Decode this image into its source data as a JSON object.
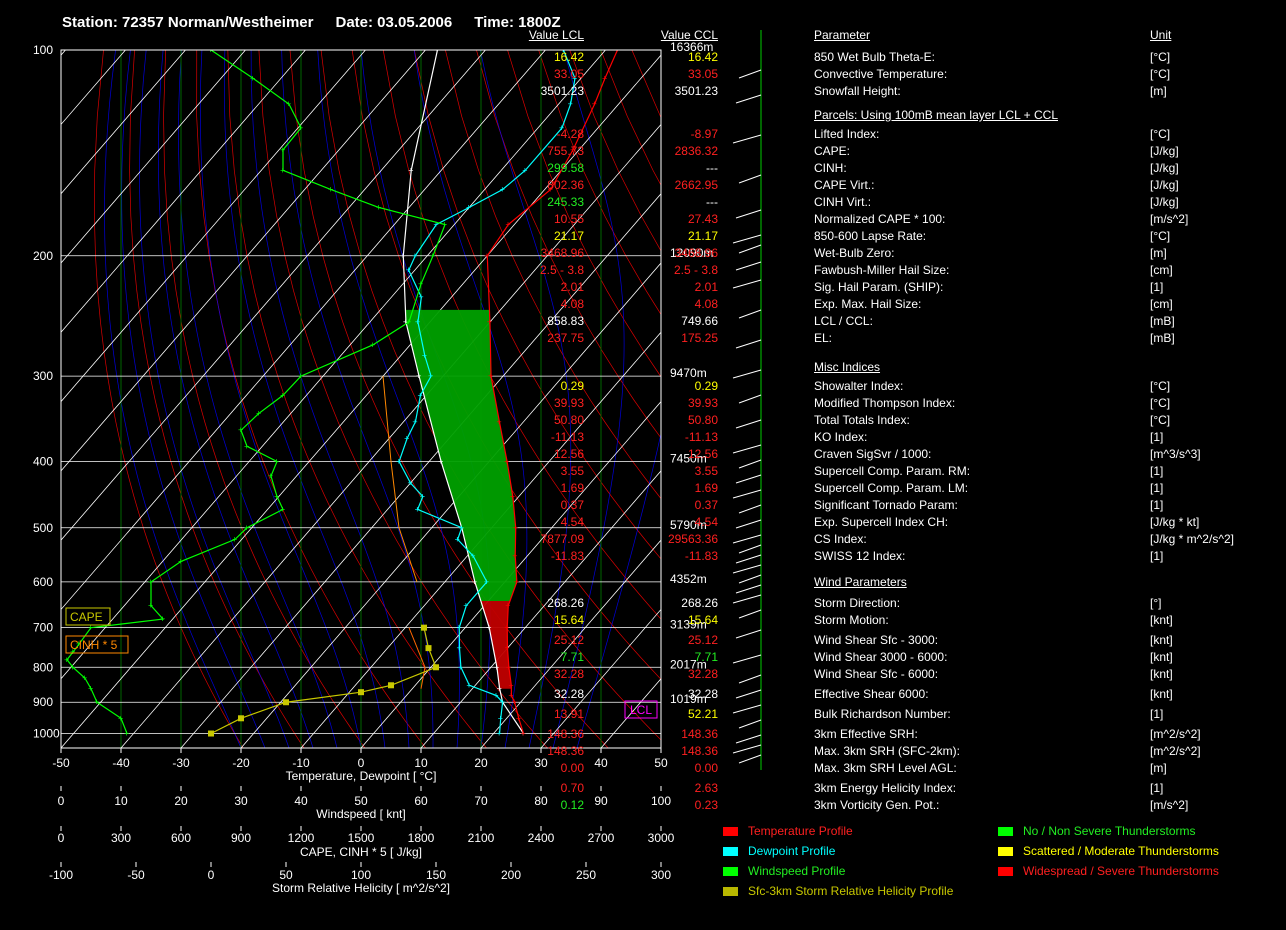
{
  "header": {
    "station": "Station: 72357 Norman/Westheimer",
    "date": "Date: 03.05.2006",
    "time": "Time: 1800Z"
  },
  "colors": {
    "temperature": "#ff0000",
    "dewpoint": "#00ffff",
    "windspeed": "#00ff00",
    "srh": "#c8c800",
    "parcel": "#ffffff",
    "cape_fill": "#00a000",
    "cinh_fill": "#c00000",
    "isotherm": "#00c000",
    "dry_adiabat": "#ff0000",
    "moist_adiabat": "#0000ff"
  },
  "table": {
    "headers": {
      "parameter": "Parameter",
      "lcl": "Value LCL",
      "ccl": "Value CCL",
      "unit": "Unit"
    },
    "sections": [
      {
        "title": "",
        "rows": [
          {
            "name": "850 Wet Bulb Theta-E:",
            "lcl": "16.42",
            "ccl": "16.42",
            "unit": "[°C]",
            "lcl_color": "y",
            "ccl_color": "y"
          },
          {
            "name": "Convective Temperature:",
            "lcl": "33.05",
            "ccl": "33.05",
            "unit": "[°C]",
            "lcl_color": "r",
            "ccl_color": "r"
          },
          {
            "name": "Snowfall Height:",
            "lcl": "3501.23",
            "ccl": "3501.23",
            "unit": "[m]",
            "lcl_color": "w",
            "ccl_color": "w"
          }
        ]
      },
      {
        "title": "Parcels: Using 100mB mean layer LCL + CCL",
        "rows": [
          {
            "name": "Lifted Index:",
            "lcl": "-4.28",
            "ccl": "-8.97",
            "unit": "[°C]",
            "lcl_color": "r",
            "ccl_color": "r"
          },
          {
            "name": "CAPE:",
            "lcl": "755.73",
            "ccl": "2836.32",
            "unit": "[J/kg]",
            "lcl_color": "r",
            "ccl_color": "r"
          },
          {
            "name": "CINH:",
            "lcl": "299.58",
            "ccl": "---",
            "unit": "[J/kg]",
            "lcl_color": "g",
            "ccl_color": "w"
          },
          {
            "name": "CAPE Virt.:",
            "lcl": "802.36",
            "ccl": "2662.95",
            "unit": "[J/kg]",
            "lcl_color": "r",
            "ccl_color": "r"
          },
          {
            "name": "CINH Virt.:",
            "lcl": "245.33",
            "ccl": "---",
            "unit": "[J/kg]",
            "lcl_color": "g",
            "ccl_color": "w"
          },
          {
            "name": "Normalized CAPE * 100:",
            "lcl": "10.55",
            "ccl": "27.43",
            "unit": "[m/s^2]",
            "lcl_color": "r",
            "ccl_color": "r"
          },
          {
            "name": "850-600 Lapse Rate:",
            "lcl": "21.17",
            "ccl": "21.17",
            "unit": "[°C]",
            "lcl_color": "y",
            "ccl_color": "y"
          },
          {
            "name": "Wet-Bulb Zero:",
            "lcl": "3468.96",
            "ccl": "3468.96",
            "unit": "[m]",
            "lcl_color": "r",
            "ccl_color": "r"
          },
          {
            "name": "Fawbush-Miller Hail Size:",
            "lcl": "2.5 - 3.8",
            "ccl": "2.5 - 3.8",
            "unit": "[cm]",
            "lcl_color": "r",
            "ccl_color": "r"
          },
          {
            "name": "Sig. Hail Param. (SHIP):",
            "lcl": "2.01",
            "ccl": "2.01",
            "unit": "[1]",
            "lcl_color": "r",
            "ccl_color": "r"
          },
          {
            "name": "Exp. Max. Hail Size:",
            "lcl": "4.08",
            "ccl": "4.08",
            "unit": "[cm]",
            "lcl_color": "r",
            "ccl_color": "r"
          },
          {
            "name": "LCL / CCL:",
            "lcl": "858.83",
            "ccl": "749.66",
            "unit": "[mB]",
            "lcl_color": "w",
            "ccl_color": "w"
          },
          {
            "name": "EL:",
            "lcl": "237.75",
            "ccl": "175.25",
            "unit": "[mB]",
            "lcl_color": "r",
            "ccl_color": "r"
          }
        ]
      },
      {
        "title": "Misc Indices",
        "rows": [
          {
            "name": "Showalter Index:",
            "lcl": "0.29",
            "ccl": "0.29",
            "unit": "[°C]",
            "lcl_color": "y",
            "ccl_color": "y"
          },
          {
            "name": "Modified Thompson Index:",
            "lcl": "39.93",
            "ccl": "39.93",
            "unit": "[°C]",
            "lcl_color": "r",
            "ccl_color": "r"
          },
          {
            "name": "Total Totals Index:",
            "lcl": "50.80",
            "ccl": "50.80",
            "unit": "[°C]",
            "lcl_color": "r",
            "ccl_color": "r"
          },
          {
            "name": "KO Index:",
            "lcl": "-11.13",
            "ccl": "-11.13",
            "unit": "[1]",
            "lcl_color": "r",
            "ccl_color": "r"
          },
          {
            "name": "Craven SigSvr / 1000:",
            "lcl": "12.56",
            "ccl": "12.56",
            "unit": "[m^3/s^3]",
            "lcl_color": "r",
            "ccl_color": "r"
          },
          {
            "name": "Supercell Comp. Param. RM:",
            "lcl": "3.55",
            "ccl": "3.55",
            "unit": "[1]",
            "lcl_color": "r",
            "ccl_color": "r"
          },
          {
            "name": "Supercell Comp. Param. LM:",
            "lcl": "1.69",
            "ccl": "1.69",
            "unit": "[1]",
            "lcl_color": "r",
            "ccl_color": "r"
          },
          {
            "name": "Significant Tornado Param:",
            "lcl": "0.37",
            "ccl": "0.37",
            "unit": "[1]",
            "lcl_color": "r",
            "ccl_color": "r"
          },
          {
            "name": "Exp. Supercell Index CH:",
            "lcl": "4.54",
            "ccl": "4.54",
            "unit": "[J/kg * kt]",
            "lcl_color": "r",
            "ccl_color": "r"
          },
          {
            "name": "CS Index:",
            "lcl": "7877.09",
            "ccl": "29563.36",
            "unit": "[J/kg * m^2/s^2]",
            "lcl_color": "r",
            "ccl_color": "r"
          },
          {
            "name": "SWISS 12 Index:",
            "lcl": "-11.83",
            "ccl": "-11.83",
            "unit": "[1]",
            "lcl_color": "r",
            "ccl_color": "r"
          }
        ]
      },
      {
        "title": "Wind Parameters",
        "rows": [
          {
            "name": "Storm Direction:",
            "lcl": "268.26",
            "ccl": "268.26",
            "unit": "[°]",
            "lcl_color": "w",
            "ccl_color": "w"
          },
          {
            "name": "Storm Motion:",
            "lcl": "15.64",
            "ccl": "15.64",
            "unit": "[knt]",
            "lcl_color": "y",
            "ccl_color": "y"
          },
          {
            "name": "Wind Shear Sfc - 3000:",
            "lcl": "25.12",
            "ccl": "25.12",
            "unit": "[knt]",
            "lcl_color": "r",
            "ccl_color": "r"
          },
          {
            "name": "Wind Shear 3000 - 6000:",
            "lcl": "7.71",
            "ccl": "7.71",
            "unit": "[knt]",
            "lcl_color": "g",
            "ccl_color": "g"
          },
          {
            "name": "Wind Shear Sfc - 6000:",
            "lcl": "32.28",
            "ccl": "32.28",
            "unit": "[knt]",
            "lcl_color": "r",
            "ccl_color": "r"
          },
          {
            "name": "Effective Shear 6000:",
            "lcl": "32.28",
            "ccl": "32.28",
            "unit": "[knt]",
            "lcl_color": "w",
            "ccl_color": "w"
          },
          {
            "name": "Bulk Richardson Number:",
            "lcl": "13.91",
            "ccl": "52.21",
            "unit": "[1]",
            "lcl_color": "r",
            "ccl_color": "y"
          },
          {
            "name": "3km Effective SRH:",
            "lcl": "148.36",
            "ccl": "148.36",
            "unit": "[m^2/s^2]",
            "lcl_color": "r",
            "ccl_color": "r"
          },
          {
            "name": "Max. 3km SRH (SFC-2km):",
            "lcl": "148.36",
            "ccl": "148.36",
            "unit": "[m^2/s^2]",
            "lcl_color": "r",
            "ccl_color": "r"
          },
          {
            "name": "Max. 3km SRH Level AGL:",
            "lcl": "0.00",
            "ccl": "0.00",
            "unit": "[m]",
            "lcl_color": "r",
            "ccl_color": "r"
          },
          {
            "name": "3km Energy Helicity Index:",
            "lcl": "0.70",
            "ccl": "2.63",
            "unit": "[1]",
            "lcl_color": "r",
            "ccl_color": "r"
          },
          {
            "name": "3km Vorticity Gen. Pot.:",
            "lcl": "0.12",
            "ccl": "0.23",
            "unit": "[m/s^2]",
            "lcl_color": "g",
            "ccl_color": "r"
          }
        ]
      }
    ]
  },
  "legend": {
    "profiles": [
      {
        "label": "Temperature Profile",
        "color": "#ff0000",
        "text_color": "#ff2020"
      },
      {
        "label": "Dewpoint Profile",
        "color": "#00ffff",
        "text_color": "#00ffff"
      },
      {
        "label": "Windspeed Profile",
        "color": "#00ff00",
        "text_color": "#22ee22"
      },
      {
        "label": "Sfc-3km Storm Relative Helicity Profile",
        "color": "#b8b800",
        "text_color": "#c8c800"
      }
    ],
    "categories": [
      {
        "label": "No / Non Severe Thunderstorms",
        "color": "#00ff00",
        "text_color": "#22ee22"
      },
      {
        "label": "Scattered / Moderate Thunderstorms",
        "color": "#ffff00",
        "text_color": "#ffff00"
      },
      {
        "label": "Widespread / Severe Thunderstorms",
        "color": "#ff0000",
        "text_color": "#ff2020"
      }
    ]
  },
  "chart_data": {
    "type": "skew-t log-p sounding",
    "pressure_ticks": [
      "100",
      "200",
      "300",
      "400",
      "500",
      "600",
      "700",
      "800",
      "900",
      "1000"
    ],
    "pressure_levels": [
      100,
      200,
      300,
      400,
      500,
      600,
      700,
      800,
      900,
      1000
    ],
    "height_labels": [
      {
        "p": 100,
        "label": "16366m"
      },
      {
        "p": 200,
        "label": "12090m"
      },
      {
        "p": 300,
        "label": "9470m"
      },
      {
        "p": 400,
        "label": "7450m"
      },
      {
        "p": 500,
        "label": "5790m"
      },
      {
        "p": 600,
        "label": "4352m"
      },
      {
        "p": 700,
        "label": "3139m"
      },
      {
        "p": 800,
        "label": "2017m"
      },
      {
        "p": 900,
        "label": "1019m"
      }
    ],
    "temperature_axis": {
      "label": "Temperature, Dewpoint  [ °C]",
      "ticks": [
        "-50",
        "-40",
        "-30",
        "-20",
        "-10",
        "0",
        "10",
        "20",
        "30",
        "40",
        "50"
      ],
      "range": [
        -50,
        50
      ]
    },
    "windspeed_axis": {
      "label": "Windspeed  [ knt]",
      "ticks": [
        "0",
        "10",
        "20",
        "30",
        "40",
        "50",
        "60",
        "70",
        "80",
        "90",
        "100"
      ],
      "range": [
        0,
        100
      ]
    },
    "cape_axis": {
      "label": "CAPE, CINH * 5  [ J/kg]",
      "ticks": [
        "0",
        "300",
        "600",
        "900",
        "1200",
        "1500",
        "1800",
        "2100",
        "2400",
        "2700",
        "3000"
      ],
      "range": [
        0,
        3000
      ]
    },
    "srh_axis": {
      "label": "Storm Relative Helicity  [ m^2/s^2]",
      "ticks": [
        "-100",
        "-50",
        "0",
        "50",
        "100",
        "150",
        "200",
        "250",
        "300"
      ],
      "range": [
        -100,
        300
      ]
    },
    "markers": {
      "cape": "CAPE",
      "cinh": "CINH * 5",
      "lcl": "LCL"
    },
    "temperature_profile": [
      [
        1000,
        25
      ],
      [
        950,
        22
      ],
      [
        900,
        19
      ],
      [
        880,
        17.5
      ],
      [
        850,
        16
      ],
      [
        800,
        13
      ],
      [
        750,
        10
      ],
      [
        700,
        7
      ],
      [
        650,
        4
      ],
      [
        600,
        2
      ],
      [
        550,
        -2
      ],
      [
        500,
        -6
      ],
      [
        450,
        -11
      ],
      [
        400,
        -17
      ],
      [
        350,
        -24
      ],
      [
        300,
        -32
      ],
      [
        250,
        -40
      ],
      [
        200,
        -50
      ],
      [
        180,
        -51
      ],
      [
        160,
        -49
      ],
      [
        140,
        -51
      ],
      [
        120,
        -54
      ],
      [
        110,
        -56
      ],
      [
        100,
        -58
      ]
    ],
    "dewpoint_profile": [
      [
        1000,
        21
      ],
      [
        950,
        19
      ],
      [
        900,
        17
      ],
      [
        880,
        15
      ],
      [
        850,
        9
      ],
      [
        800,
        5
      ],
      [
        750,
        2
      ],
      [
        700,
        -1
      ],
      [
        650,
        -3
      ],
      [
        600,
        -3
      ],
      [
        550,
        -9
      ],
      [
        520,
        -14
      ],
      [
        500,
        -15
      ],
      [
        470,
        -25
      ],
      [
        450,
        -26
      ],
      [
        430,
        -30
      ],
      [
        400,
        -35
      ],
      [
        370,
        -37
      ],
      [
        350,
        -38
      ],
      [
        320,
        -41
      ],
      [
        300,
        -42
      ],
      [
        280,
        -46
      ],
      [
        250,
        -52
      ],
      [
        230,
        -55
      ],
      [
        210,
        -61
      ],
      [
        200,
        -62
      ],
      [
        180,
        -63
      ],
      [
        170,
        -60
      ],
      [
        160,
        -57
      ],
      [
        150,
        -56
      ],
      [
        130,
        -56
      ],
      [
        120,
        -58
      ],
      [
        110,
        -61
      ],
      [
        100,
        -67
      ]
    ],
    "parcel_profile": [
      [
        1000,
        25
      ],
      [
        900,
        17
      ],
      [
        859,
        14.5
      ],
      [
        800,
        11
      ],
      [
        700,
        4
      ],
      [
        600,
        -5
      ],
      [
        500,
        -15
      ],
      [
        400,
        -28
      ],
      [
        300,
        -44
      ],
      [
        250,
        -54
      ],
      [
        200,
        -64
      ],
      [
        150,
        -75
      ],
      [
        100,
        -88
      ]
    ],
    "windspeed_profile_knt": [
      [
        1000,
        11
      ],
      [
        950,
        10
      ],
      [
        900,
        6
      ],
      [
        860,
        5
      ],
      [
        830,
        4
      ],
      [
        800,
        2
      ],
      [
        780,
        1
      ],
      [
        760,
        2
      ],
      [
        740,
        3
      ],
      [
        700,
        5
      ],
      [
        680,
        17
      ],
      [
        650,
        15
      ],
      [
        600,
        15
      ],
      [
        560,
        20
      ],
      [
        520,
        29
      ],
      [
        500,
        31
      ],
      [
        470,
        37
      ],
      [
        450,
        36
      ],
      [
        420,
        35
      ],
      [
        400,
        36
      ],
      [
        380,
        31
      ],
      [
        360,
        30
      ],
      [
        340,
        33
      ],
      [
        320,
        37
      ],
      [
        300,
        40
      ],
      [
        270,
        52
      ],
      [
        250,
        58
      ],
      [
        220,
        60
      ],
      [
        200,
        62
      ],
      [
        180,
        64
      ],
      [
        170,
        53
      ],
      [
        160,
        45
      ],
      [
        150,
        37
      ],
      [
        140,
        37
      ],
      [
        130,
        40
      ],
      [
        120,
        38
      ],
      [
        110,
        32
      ],
      [
        100,
        25
      ]
    ],
    "cape_profile_jkg": [
      [
        300,
        1610
      ],
      [
        400,
        1650
      ],
      [
        500,
        1690
      ],
      [
        600,
        1780
      ]
    ],
    "cinh_profile_jkg": [
      [
        700,
        1740
      ],
      [
        800,
        1820
      ],
      [
        860,
        1800
      ]
    ],
    "srh_profile": [
      [
        1000,
        0
      ],
      [
        950,
        20
      ],
      [
        900,
        50
      ],
      [
        870,
        100
      ],
      [
        850,
        120
      ],
      [
        800,
        150
      ],
      [
        750,
        145
      ],
      [
        700,
        142
      ]
    ],
    "grid": true,
    "legend_position": "bottom"
  }
}
